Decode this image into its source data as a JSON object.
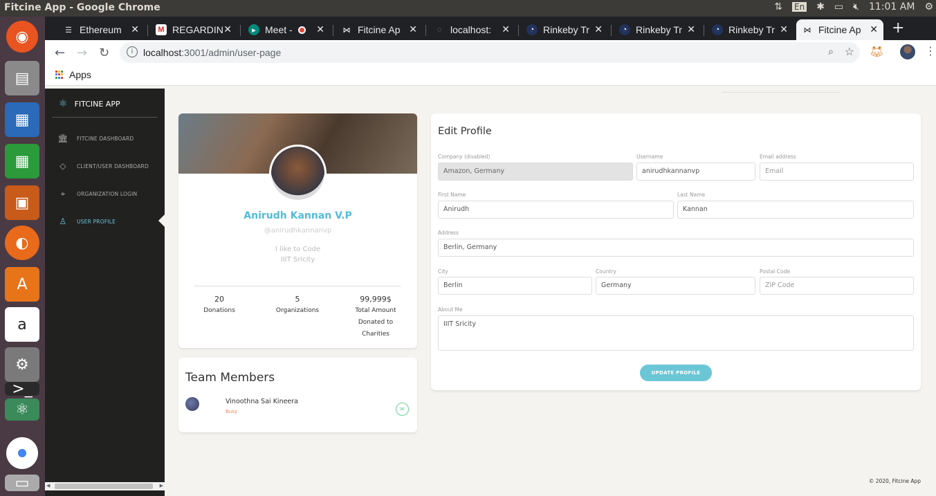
{
  "os": {
    "window_title": "Fitcine App - Google Chrome",
    "lang": "En",
    "clock": "11:01 AM"
  },
  "browser": {
    "tabs": [
      {
        "label": "Ethereum",
        "icon": "ethereum-icon"
      },
      {
        "label": "REGARDIN",
        "icon": "gmail-icon"
      },
      {
        "label": "Meet - ",
        "icon": "meet-icon"
      },
      {
        "label": "Fitcine Ap",
        "icon": "fitcine-icon"
      },
      {
        "label": "localhost:",
        "icon": "globe-icon"
      },
      {
        "label": "Rinkeby Tr",
        "icon": "etherscan-icon"
      },
      {
        "label": "Rinkeby Tr",
        "icon": "etherscan-icon"
      },
      {
        "label": "Rinkeby Tr",
        "icon": "etherscan-icon"
      },
      {
        "label": "Fitcine Ap",
        "icon": "fitcine-icon",
        "active": true
      }
    ],
    "url_host": "localhost",
    "url_path": ":3001/admin/user-page",
    "bookmark_apps": "Apps"
  },
  "sidebar": {
    "brand": "FITCINE APP",
    "items": [
      {
        "label": "FITCINE DASHBOARD",
        "icon": "bank-icon"
      },
      {
        "label": "CLIENT/USER DASHBOARD",
        "icon": "diamond-icon"
      },
      {
        "label": "ORGANIZATION LOGIN",
        "icon": "map-pin-icon"
      },
      {
        "label": "USER PROFILE",
        "icon": "user-icon",
        "active": true
      }
    ]
  },
  "profile": {
    "name": "Anirudh Kannan V.P",
    "handle": "@anirudhkannanvp",
    "bio_line1": "I like to Code",
    "bio_line2": "IIIT Sricity",
    "stats": [
      {
        "value": "20",
        "label": "Donations"
      },
      {
        "value": "5",
        "label": "Organizations"
      },
      {
        "value": "99,999$",
        "label_lines": [
          "Total Amount",
          "Donated to",
          "Charities"
        ]
      }
    ]
  },
  "team": {
    "title": "Team Members",
    "members": [
      {
        "name": "Vinoothna Sai Kineera",
        "status": "Busy"
      }
    ]
  },
  "edit": {
    "title": "Edit Profile",
    "company_label": "Company (disabled)",
    "company_value": "Amazon, Germany",
    "username_label": "Username",
    "username_value": "anirudhkannanvp",
    "email_label": "Email address",
    "email_placeholder": "Email",
    "first_label": "First Name",
    "first_value": "Anirudh",
    "last_label": "Last Name",
    "last_value": "Kannan",
    "address_label": "Address",
    "address_value": "Berlin, Germany",
    "city_label": "City",
    "city_value": "Berlin",
    "country_label": "Country",
    "country_value": "Germany",
    "postal_label": "Postal Code",
    "postal_placeholder": "ZIP Code",
    "about_label": "About Me",
    "about_value": "IIIT Sricity",
    "update_label": "UPDATE PROFILE"
  },
  "footer": "© 2020, Fitcine App"
}
